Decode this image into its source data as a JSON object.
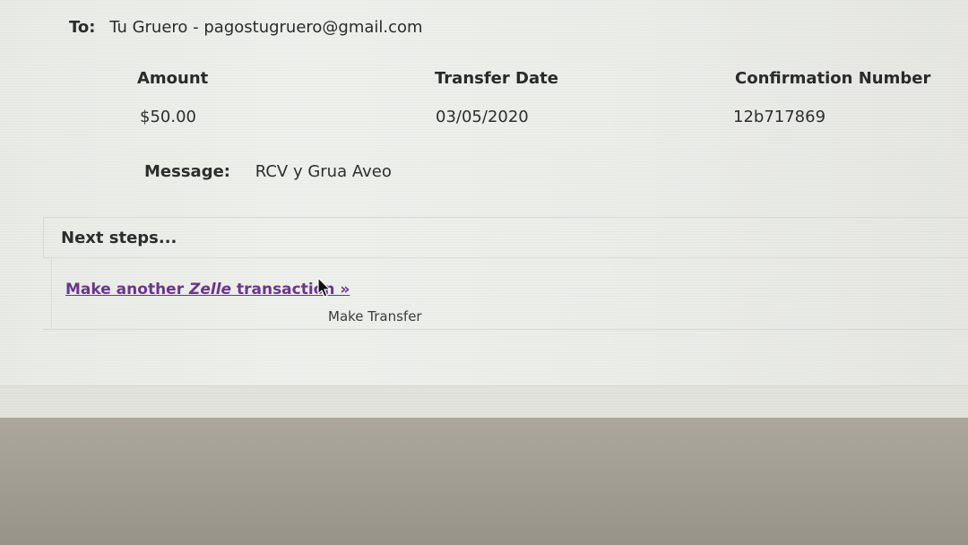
{
  "recipient": {
    "label": "To:",
    "value": "Tu Gruero - pagostugruero@gmail.com"
  },
  "details": {
    "amount": {
      "label": "Amount",
      "value": "$50.00"
    },
    "transfer_date": {
      "label": "Transfer Date",
      "value": "03/05/2020"
    },
    "confirmation": {
      "label": "Confirmation Number",
      "value": "12b717869"
    }
  },
  "message": {
    "label": "Message:",
    "value": "RCV y Grua Aveo"
  },
  "next_steps": {
    "title": "Next steps...",
    "link_prefix": "Make another ",
    "link_brand": "Zelle",
    "link_suffix": " transaction »",
    "tooltip": "Make Transfer"
  },
  "colors": {
    "link": "#6b3591",
    "text": "#2b2b2b"
  },
  "icons": {
    "cursor": "arrow-cursor-icon"
  }
}
